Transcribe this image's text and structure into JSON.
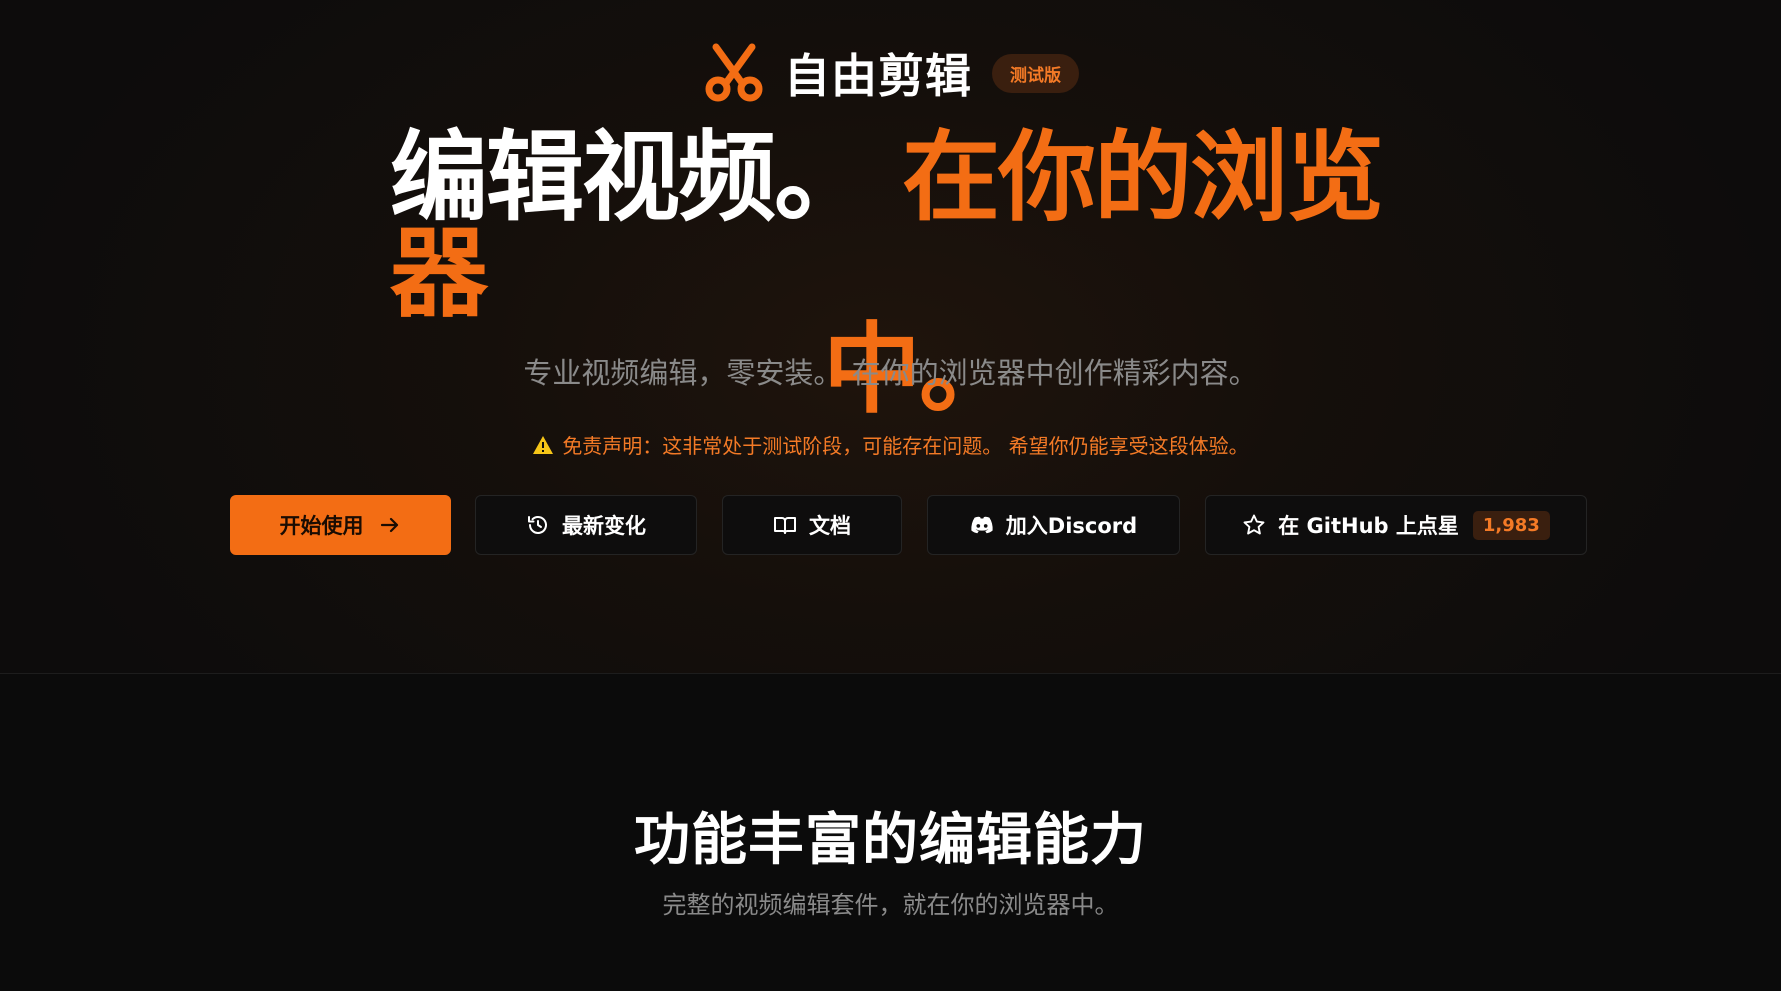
{
  "brand": {
    "name": "自由剪辑",
    "badge": "测试版",
    "logo_icon": "scissors-icon",
    "accent_color": "#f36d14"
  },
  "hero": {
    "headline_part1": "编辑视频。",
    "headline_part2": "在你的浏览器",
    "headline_part3": "中。",
    "subtitle": "专业视频编辑，零安装。 在你的浏览器中创作精彩内容。",
    "disclaimer": "免责声明：这非常处于测试阶段，可能存在问题。 希望你仍能享受这段体验。",
    "disclaimer_icon": "warning-icon"
  },
  "actions": {
    "get_started": {
      "label": "开始使用",
      "icon": "arrow-right-icon"
    },
    "changelog": {
      "label": "最新变化",
      "icon": "history-icon"
    },
    "docs": {
      "label": "文档",
      "icon": "book-icon"
    },
    "discord": {
      "label": "加入Discord",
      "icon": "discord-icon"
    },
    "github": {
      "label": "在 GitHub 上点星",
      "icon": "star-icon",
      "count": "1,983"
    }
  },
  "features": {
    "title": "功能丰富的编辑能力",
    "subtitle": "完整的视频编辑套件，就在你的浏览器中。"
  }
}
